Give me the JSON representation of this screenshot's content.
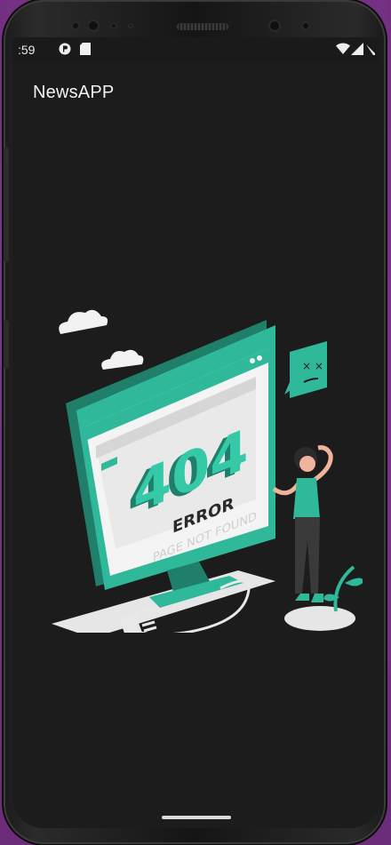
{
  "status": {
    "time": ":59",
    "icons": [
      "p-icon",
      "sd-card-icon",
      "wifi-icon",
      "signal-icon",
      "battery-icon"
    ]
  },
  "app": {
    "title": "NewsAPP"
  },
  "error": {
    "code": "404",
    "heading": "ERROR",
    "message": "PAGE NOT FOUND"
  },
  "colors": {
    "accent": "#2fb89a",
    "accent_dark": "#1f7f6b",
    "background": "#1c1c1c",
    "frame": "#8a3d9a"
  }
}
